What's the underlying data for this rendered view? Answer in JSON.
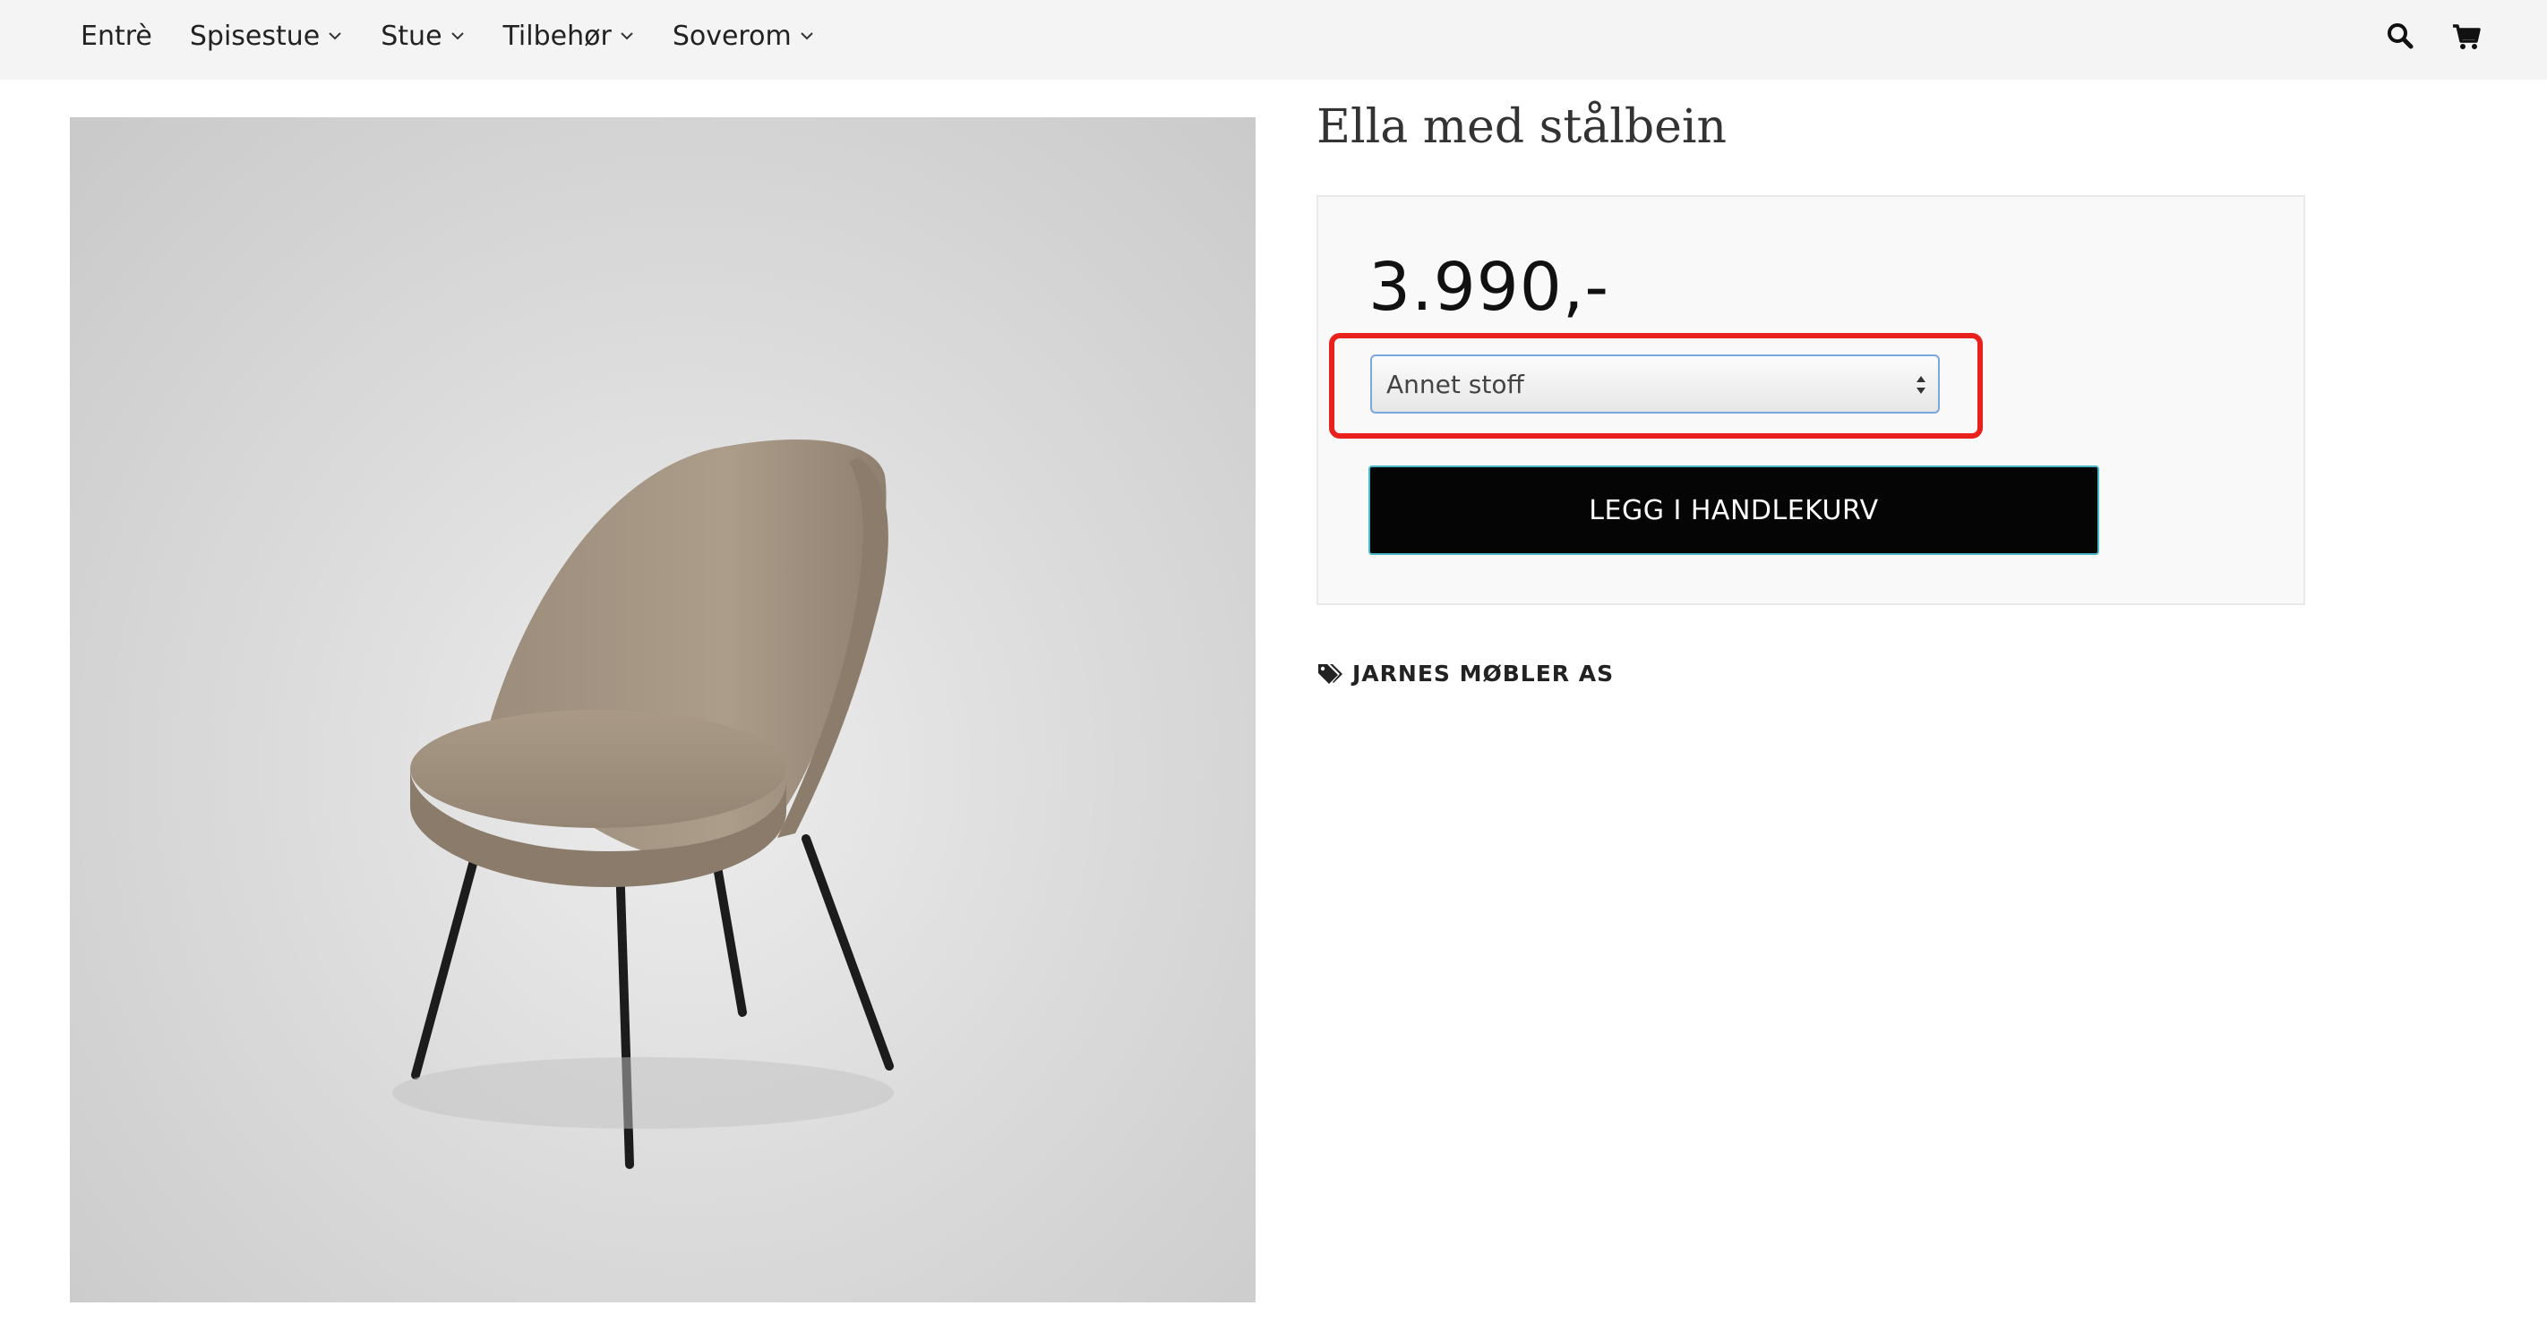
{
  "nav": {
    "items": [
      {
        "label": "Entrè",
        "has_dropdown": false
      },
      {
        "label": "Spisestue",
        "has_dropdown": true
      },
      {
        "label": "Stue",
        "has_dropdown": true
      },
      {
        "label": "Tilbehør",
        "has_dropdown": true
      },
      {
        "label": "Soverom",
        "has_dropdown": true
      }
    ],
    "icons": [
      "search-icon",
      "cart-icon"
    ]
  },
  "product": {
    "title": "Ella med stålbein",
    "price": "3.990,-",
    "variant_selected": "Annet stoff",
    "add_to_cart_label": "LEGG I HANDLEKURV",
    "brand": "JARNES MØBLER AS"
  },
  "colors": {
    "highlight": "#e8211c",
    "button_bg": "#050505",
    "button_border": "#49b7c6",
    "select_border": "#7aa7de",
    "chair_fabric": "#a89886",
    "chair_legs": "#1c1c1c"
  }
}
